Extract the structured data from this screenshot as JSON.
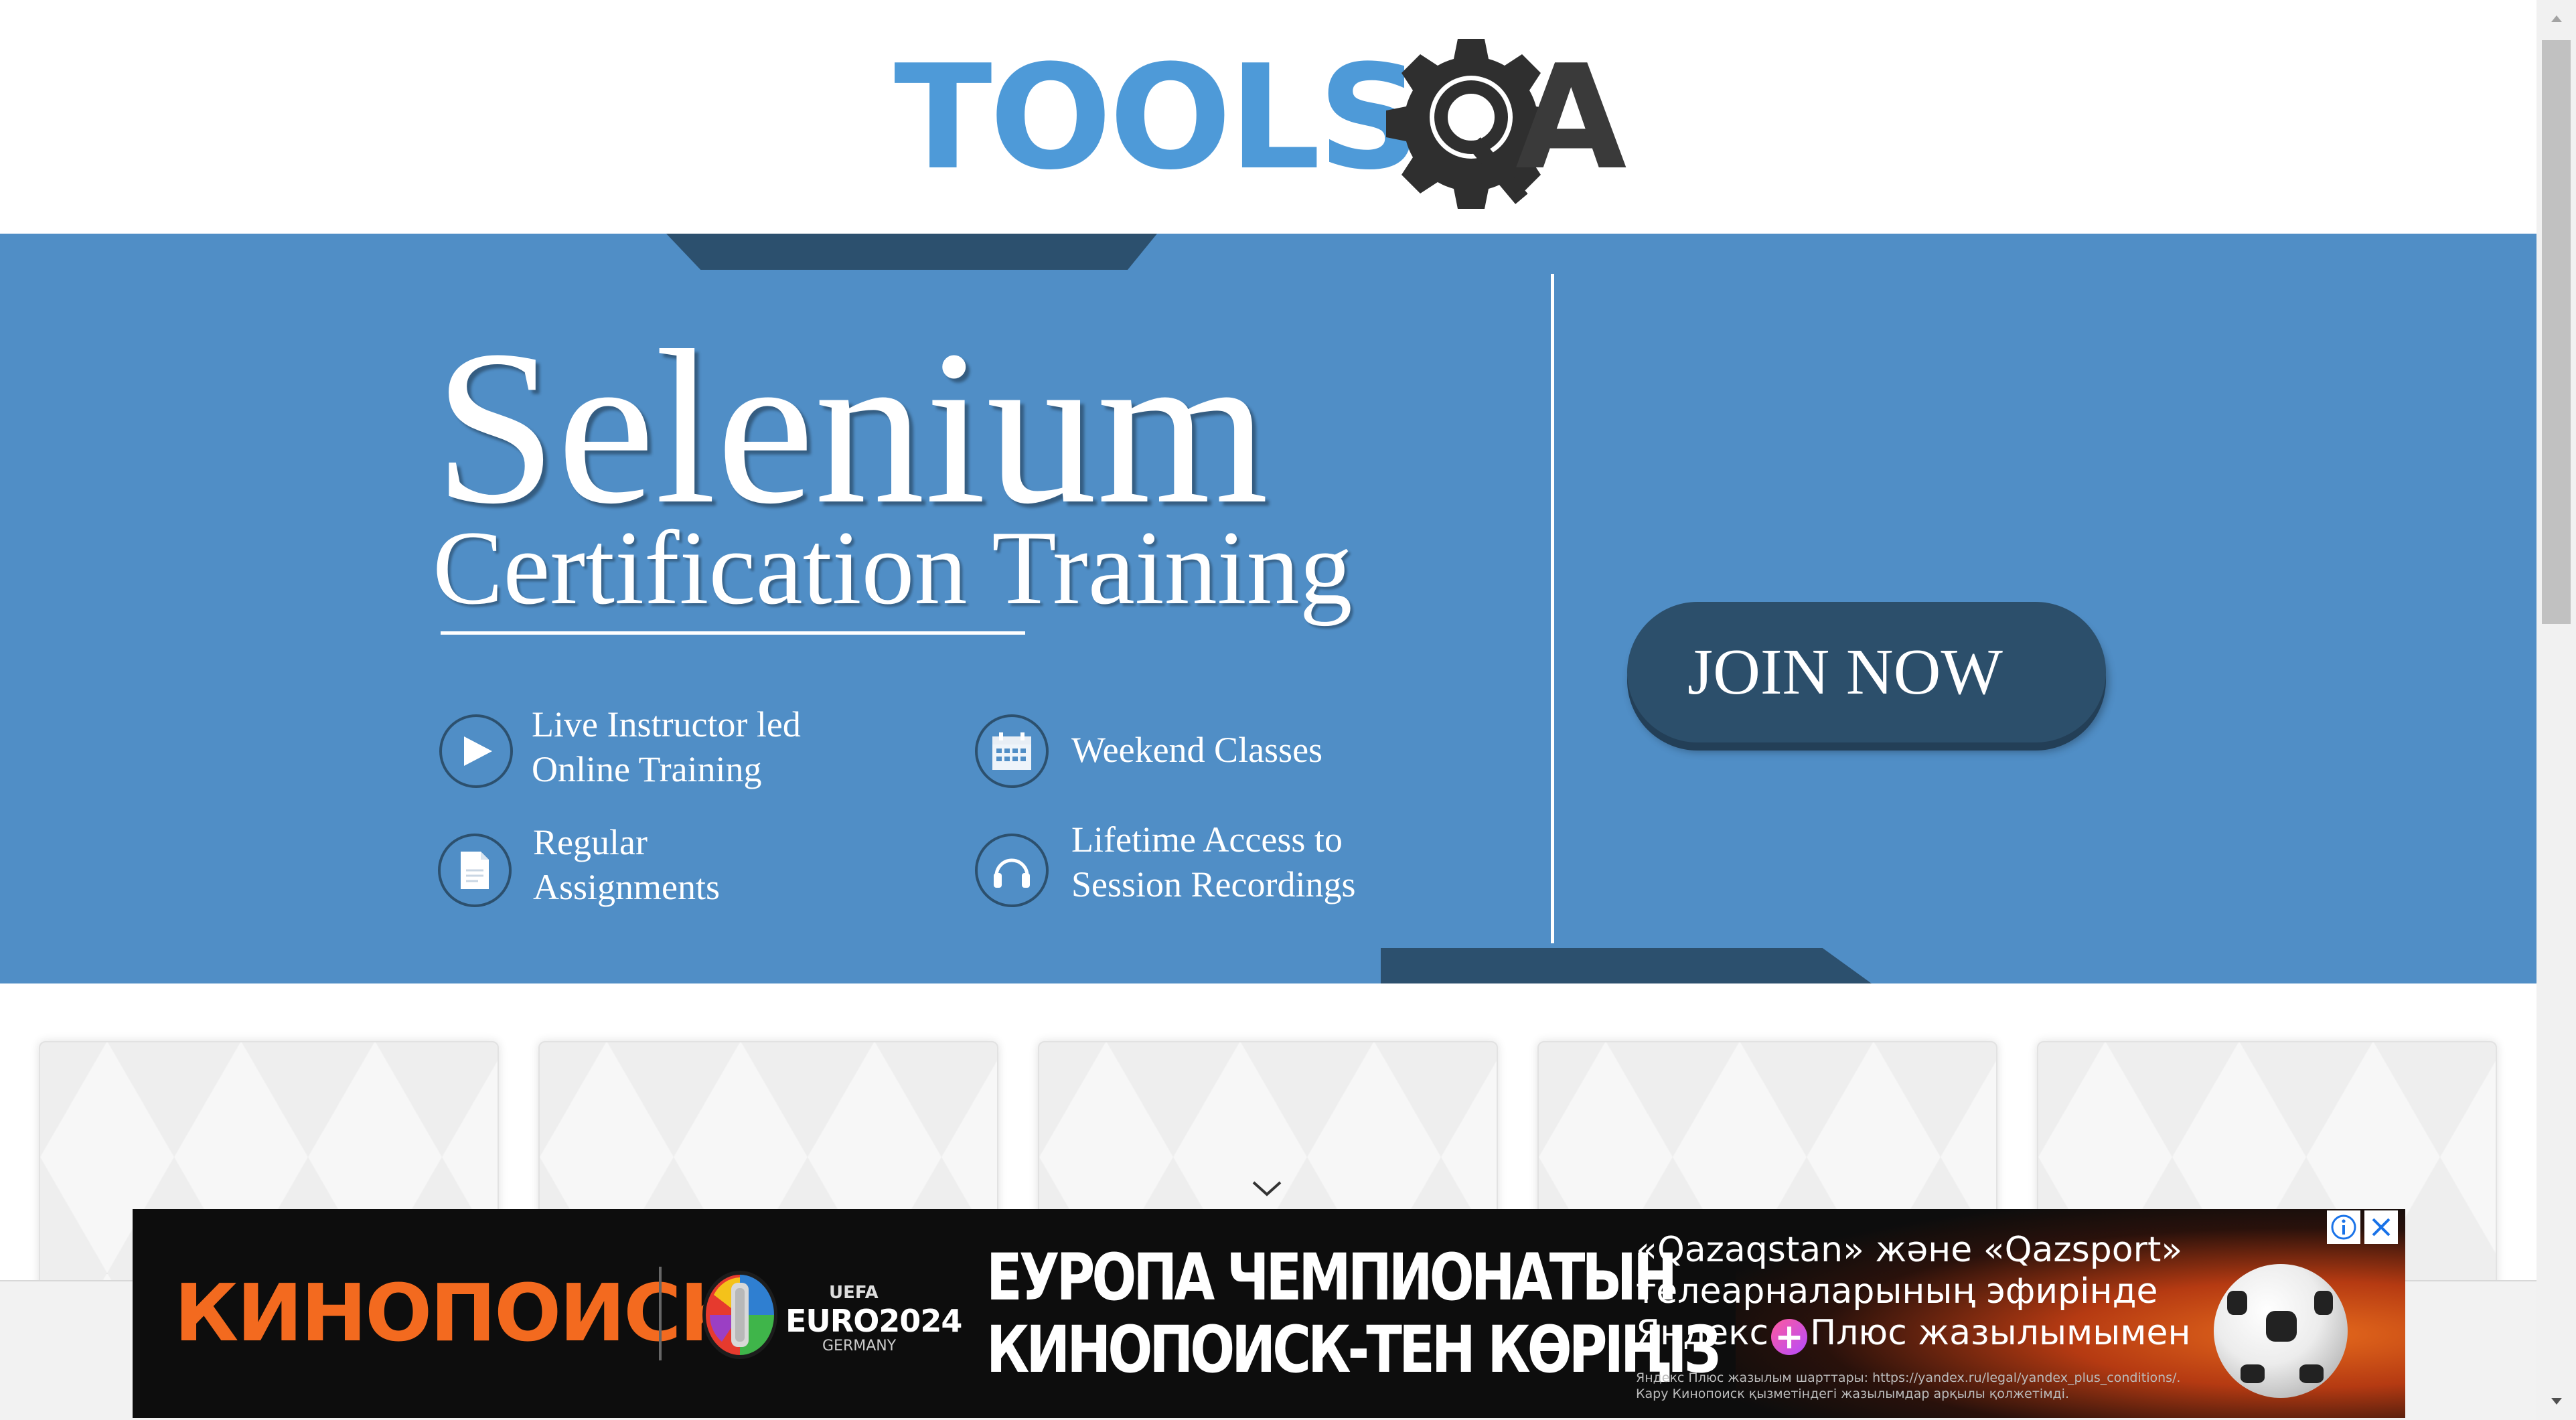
{
  "header": {
    "logo_primary": "TOOLS",
    "logo_secondary": "A",
    "logo_icon": "gear-magnifier-icon",
    "colors": {
      "logo_blue": "#4e9ad8",
      "logo_dark": "#3a3a3a"
    }
  },
  "banner": {
    "title": "Selenium",
    "subtitle": "Certification Training",
    "features": [
      {
        "icon": "play-icon",
        "line1": "Live Instructor led",
        "line2": "Online Training"
      },
      {
        "icon": "calendar-icon",
        "line1": "Weekend Classes",
        "line2": ""
      },
      {
        "icon": "document-icon",
        "line1": "Regular",
        "line2": "Assignments"
      },
      {
        "icon": "headphones-icon",
        "line1": "Lifetime Access to",
        "line2": "Session Recordings"
      }
    ],
    "cta_label": "JOIN NOW",
    "colors": {
      "background": "#508ec6",
      "accent_dark": "#2c506e",
      "button": "#2c4f6b"
    }
  },
  "cards": {
    "count": 5
  },
  "scroll_hint_icon": "chevron-down-icon",
  "ad": {
    "brand": "КИНОПОИСК",
    "euro_top": "UEFA",
    "euro_label": "EURO2024",
    "euro_sub": "GERMANY",
    "headline_line1": "ЕУРОПА ЧЕМПИОНАТЫН",
    "headline_line2": "КИНОПОИСК-ТЕН КӨРІҢІЗ",
    "copy_line1": "«Qazaqstan» және «Qazsport»",
    "copy_line2": "телеарналарының эфирінде",
    "copy_line3_a": "Яндекс",
    "copy_line3_b": "Плюс жазылымымен",
    "fine_line1": "Яндекс Плюс жазылым шарттары: https://yandex.ru/legal/yandex_plus_conditions/.",
    "fine_line2": "Кару Кинопоиск қызметіндегі жазылымдар арқылы қолжетімді.",
    "info_icon": "info-icon",
    "close_icon": "close-icon",
    "colors": {
      "brand_orange": "#f36a1f",
      "background": "#0d0d0d"
    }
  }
}
